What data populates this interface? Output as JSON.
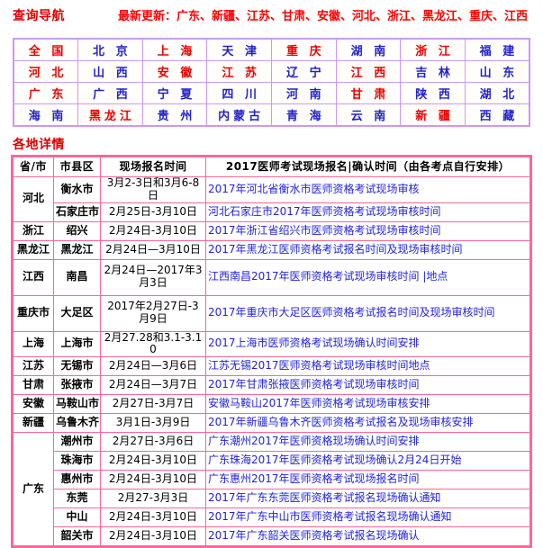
{
  "header": {
    "nav_title": "查询导航",
    "latest_update": "最新更新：广东、新疆、江苏、甘肃、安徽、河北、浙江、黑龙江、重庆、江西"
  },
  "nav_grid": {
    "colors": {
      "red": "#EE0000",
      "blue": "#2222CC",
      "border": "#CC99EE"
    },
    "rows": [
      [
        {
          "label": "全 国",
          "color": "red"
        },
        {
          "label": "北 京",
          "color": "blue"
        },
        {
          "label": "上 海",
          "color": "red"
        },
        {
          "label": "天 津",
          "color": "blue"
        },
        {
          "label": "重 庆",
          "color": "red"
        },
        {
          "label": "湖 南",
          "color": "blue"
        },
        {
          "label": "浙 江",
          "color": "red"
        },
        {
          "label": "福 建",
          "color": "blue"
        }
      ],
      [
        {
          "label": "河 北",
          "color": "red"
        },
        {
          "label": "山 西",
          "color": "blue"
        },
        {
          "label": "安 徽",
          "color": "red"
        },
        {
          "label": "江 苏",
          "color": "red"
        },
        {
          "label": "辽 宁",
          "color": "blue"
        },
        {
          "label": "江 西",
          "color": "red"
        },
        {
          "label": "吉 林",
          "color": "blue"
        },
        {
          "label": "山 东",
          "color": "blue"
        }
      ],
      [
        {
          "label": "广 东",
          "color": "red"
        },
        {
          "label": "广 西",
          "color": "blue"
        },
        {
          "label": "宁 夏",
          "color": "blue"
        },
        {
          "label": "四 川",
          "color": "blue"
        },
        {
          "label": "河 南",
          "color": "blue"
        },
        {
          "label": "甘 肃",
          "color": "red"
        },
        {
          "label": "陕 西",
          "color": "blue"
        },
        {
          "label": "湖 北",
          "color": "blue"
        }
      ],
      [
        {
          "label": "海 南",
          "color": "blue"
        },
        {
          "label": "黑龙江",
          "color": "red"
        },
        {
          "label": "贵 州",
          "color": "blue"
        },
        {
          "label": "内蒙古",
          "color": "blue"
        },
        {
          "label": "青 海",
          "color": "blue"
        },
        {
          "label": "云 南",
          "color": "blue"
        },
        {
          "label": "新 疆",
          "color": "red"
        },
        {
          "label": "西 藏",
          "color": "blue"
        }
      ]
    ]
  },
  "section": {
    "title": "各地详情"
  },
  "table": {
    "border_color": "#FF6699",
    "link_color": "#2222DD",
    "headers": [
      "省/市",
      "市县区",
      "现场报名时间",
      "2017医师考试现场报名|确认时间（由各考点自行安排）"
    ],
    "rows": [
      {
        "province": "河北",
        "province_rowspan": 2,
        "city": "衡水市",
        "time": "3月2-3日和3月6-8日",
        "note": "2017年河北省衡水市医师资格考试现场审核",
        "tall": false
      },
      {
        "province": null,
        "city": "石家庄市",
        "time": "2月25日-3月10日",
        "note": "河北石家庄市2017年医师资格考试现场审核时间",
        "tall": false
      },
      {
        "province": "浙江",
        "province_rowspan": 1,
        "city": "绍兴",
        "time": "2月24日-3月10日",
        "note": "2017年浙江省绍兴市医师资格考试现场审核时间",
        "tall": false
      },
      {
        "province": "黑龙江",
        "province_rowspan": 1,
        "city": "黑龙江",
        "time": "2月24日—3月10日",
        "note": "2017年黑龙江医师资格考试报名时间及现场审核时间",
        "tall": false
      },
      {
        "province": "江西",
        "province_rowspan": 1,
        "city": "南昌",
        "time": "2月24日—2017年3月3日",
        "note": "江西南昌2017年医师资格考试现场审核时间 |地点",
        "tall": true
      },
      {
        "province": "重庆市",
        "province_rowspan": 1,
        "city": "大足区",
        "time": "2017年2月27日-3月9日",
        "note": "2017年重庆市大足区医师资格考试报名时间及现场审核时间",
        "tall": true
      },
      {
        "province": "上海",
        "province_rowspan": 1,
        "city": "上海市",
        "time": "2月27.28和3.1-3.10",
        "note": "2017上海市医师资格考试现场确认时间安排",
        "tall": false
      },
      {
        "province": "江苏",
        "province_rowspan": 1,
        "city": "无锡市",
        "time": "2月24日—3月6日",
        "note": "江苏无锡2017医师资格考试现场审核时间地点",
        "tall": false
      },
      {
        "province": "甘肃",
        "province_rowspan": 1,
        "city": "张掖市",
        "time": "2月24日—3月7日",
        "note": "2017年甘肃张掖医师资格考试现场审核时间",
        "tall": false
      },
      {
        "province": "安徽",
        "province_rowspan": 1,
        "city": "马鞍山市",
        "time": "2月27日-3月7日",
        "note": "安徽马鞍山2017年医师资格考试现场审核安排",
        "tall": false
      },
      {
        "province": "新疆",
        "province_rowspan": 1,
        "city": "乌鲁木齐",
        "time": "3月1日-3月9日",
        "note": "2017年新疆乌鲁木齐医师资格考试报名及现场审核安排",
        "tall": false
      },
      {
        "province": "广东",
        "province_rowspan": 6,
        "city": "潮州市",
        "time": "2月27日-3月6日",
        "note": "广东潮州2017年医师资格现场确认时间安排",
        "tall": false
      },
      {
        "province": null,
        "city": "珠海市",
        "time": "2月24日-3月10日",
        "note": "广东珠海2017年医师资格考试现场确认2月24日开始",
        "tall": false
      },
      {
        "province": null,
        "city": "惠州市",
        "time": "2月24日-3月10日",
        "note": "广东惠州2017年医师资格考试现场报名时间",
        "tall": false
      },
      {
        "province": null,
        "city": "东莞",
        "time": "2月27-3月3日",
        "note": "2017年广东东莞医师资格考试报名现场确认通知",
        "tall": false
      },
      {
        "province": null,
        "city": "中山",
        "time": "2月24日-3月10日",
        "note": "2017年广东中山市医师资格考试报名现场确认通知",
        "tall": false
      },
      {
        "province": null,
        "city": "韶关市",
        "time": "2月24日-3月10日",
        "note": "2017年广东韶关医师资格考试报名现场确认",
        "tall": false
      }
    ]
  }
}
